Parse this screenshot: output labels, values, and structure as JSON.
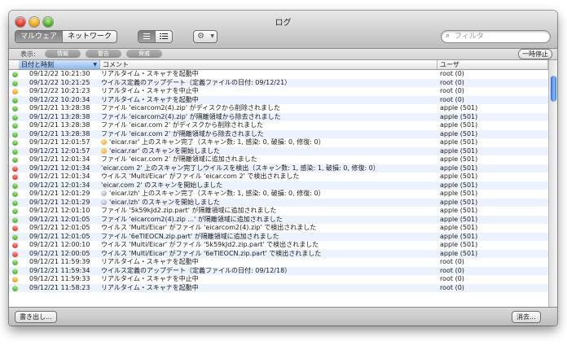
{
  "window": {
    "title": "ログ"
  },
  "toolbar": {
    "tabs": [
      "マルウェア",
      "ネットワーク"
    ],
    "search_placeholder": "フィルタ",
    "view_icons": [
      "list-view-icon",
      "detail-view-icon"
    ],
    "action_icon": "gear-icon"
  },
  "filter": {
    "label": "表示:",
    "buttons": [
      "情報",
      "警告",
      "脅威"
    ],
    "pause_label": "一時停止"
  },
  "table": {
    "columns": [
      "日付と時刻",
      "コメント",
      "ユーザ"
    ],
    "sorted_column": "日付と時刻",
    "status_colors": {
      "green": "#2f9a17",
      "orange": "#e08a00",
      "red": "#cc1b0f"
    },
    "rows": [
      {
        "status": "green",
        "date": "09/12/22 10:21:30",
        "comment": "リアルタイム・スキャナを起動中",
        "user": "root (0)"
      },
      {
        "status": "green",
        "date": "09/12/22 10:21:25",
        "comment": "ウイルス定義のアップデート（定義ファイルの日付: 09/12/21）",
        "user": "root (0)"
      },
      {
        "status": "orange",
        "date": "09/12/22 10:21:23",
        "comment": "リアルタイム・スキャナを中止中",
        "user": "root (0)"
      },
      {
        "status": "green",
        "date": "09/12/22 10:20:34",
        "comment": "リアルタイム・スキャナを起動中",
        "user": "root (0)"
      },
      {
        "status": "green",
        "date": "09/12/21 13:28:38",
        "comment": "ファイル 'eicarcom2(4).zip' がディスクから削除されました",
        "user": "apple (501)"
      },
      {
        "status": "green",
        "date": "09/12/21 13:28:38",
        "comment": "ファイル 'eicarcom2(4).zip' が隔離領域から除去されました",
        "user": "apple (501)"
      },
      {
        "status": "green",
        "date": "09/12/21 13:28:38",
        "comment": "ファイル 'eicar.com 2' がディスクから削除されました",
        "user": "apple (501)"
      },
      {
        "status": "green",
        "date": "09/12/21 13:28:38",
        "comment": "ファイル 'eicar.com 2' が隔離領域から除去されました",
        "user": "apple (501)"
      },
      {
        "status": "green",
        "date": "09/12/21 12:01:57",
        "icon": "rar",
        "comment": "'eicar.rar' 上のスキャン完了（スキャン数: 1, 感染: 0, 破損: 0, 修復: 0）",
        "user": "apple (501)"
      },
      {
        "status": "green",
        "date": "09/12/21 12:01:57",
        "icon": "rar",
        "comment": "'eicar.rar' のスキャンを開始しました",
        "user": "apple (501)"
      },
      {
        "status": "green",
        "date": "09/12/21 12:01:34",
        "comment": "ファイル 'eicar.com 2' が隔離領域に追加されました",
        "user": "apple (501)"
      },
      {
        "status": "red",
        "date": "09/12/21 12:01:34",
        "comment": "'eicar.com 2' 上のスキャン完了しウイルスを検出（スキャン数: 1, 感染: 1, 破損: 0, 修復: 0）",
        "user": "apple (501)"
      },
      {
        "status": "red",
        "date": "09/12/21 12:01:34",
        "comment": "ウイルス 'Multi/Eicar' がファイル 'eicar.com 2' で検出されました",
        "user": "apple (501)"
      },
      {
        "status": "green",
        "date": "09/12/21 12:01:34",
        "comment": "'eicar.com 2' のスキャンを開始しました",
        "user": "apple (501)"
      },
      {
        "status": "green",
        "date": "09/12/21 12:01:29",
        "icon": "lzh",
        "comment": "'eicar.lzh' 上のスキャン完了（スキャン数: 1, 感染: 0, 破損: 0, 修復: 0）",
        "user": "apple (501)"
      },
      {
        "status": "green",
        "date": "09/12/21 12:01:29",
        "icon": "lzh",
        "comment": "'eicar.lzh' のスキャンを開始しました",
        "user": "apple (501)"
      },
      {
        "status": "green",
        "date": "09/12/21 12:01:10",
        "comment": "ファイル '5k59kJd2.zip.part' が隔離領域に追加されました",
        "user": "apple (501)"
      },
      {
        "status": "green",
        "date": "09/12/21 12:01:05",
        "comment": "ファイル 'eicarcom2(4).zip ...' が隔離領域に追加されました",
        "user": "apple (501)"
      },
      {
        "status": "red",
        "date": "09/12/21 12:01:05",
        "comment": "ウイルス 'Multi/Eicar' がファイル 'eicarcom2(4).zip' で検出されました",
        "user": "apple (501)"
      },
      {
        "status": "green",
        "date": "09/12/21 12:01:05",
        "comment": "ファイル '6eTIEOCN.zip.part' が隔離領域に追加されました",
        "user": "apple (501)"
      },
      {
        "status": "red",
        "date": "09/12/21 12:00:10",
        "comment": "ウイルス 'Multi/Eicar' がファイル '5k59kJd2.zip.part' で検出されました",
        "user": "apple (501)"
      },
      {
        "status": "red",
        "date": "09/12/21 12:00:05",
        "comment": "ウイルス 'Multi/Eicar' がファイル '6eTIEOCN.zip.part' で検出されました",
        "user": "apple (501)"
      },
      {
        "status": "green",
        "date": "09/12/21 11:59:39",
        "comment": "リアルタイム・スキャナを起動中",
        "user": "root (0)"
      },
      {
        "status": "green",
        "date": "09/12/21 11:59:34",
        "comment": "ウイルス定義のアップデート（定義ファイルの日付: 09/12/18）",
        "user": "root (0)"
      },
      {
        "status": "orange",
        "date": "09/12/21 11:59:33",
        "comment": "リアルタイム・スキャナを中止中",
        "user": "root (0)"
      },
      {
        "status": "green",
        "date": "09/12/21 11:58:23",
        "comment": "リアルタイム・スキャナを起動中",
        "user": "root (0)"
      }
    ]
  },
  "bottom": {
    "export_label": "書き出し...",
    "clear_label": "消去..."
  }
}
